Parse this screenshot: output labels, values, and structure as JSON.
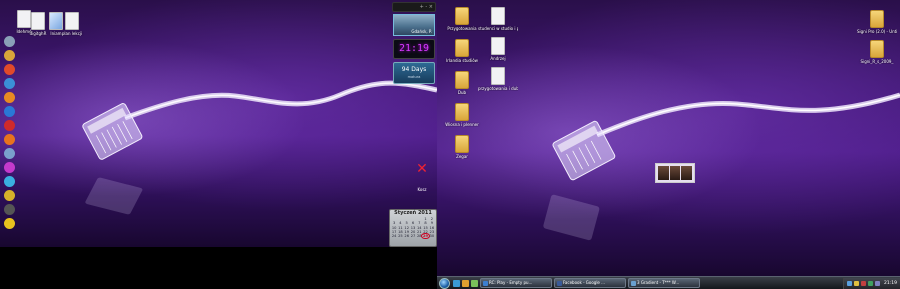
{
  "left_desktop": {
    "icons": [
      {
        "label": "Idehmé",
        "kind": "doc"
      },
      {
        "label": "digitghR",
        "kind": "doc"
      },
      {
        "label": "Iniam",
        "kind": "doc"
      },
      {
        "label": "plan lekcji",
        "kind": "doc"
      }
    ],
    "dock": [
      {
        "icon": "recycle-bin-icon",
        "color": "#8aa0b8"
      },
      {
        "icon": "folder-icon",
        "color": "#d9a53a"
      },
      {
        "icon": "chrome-icon",
        "color": "#e04a2a"
      },
      {
        "icon": "media-player-icon",
        "color": "#3b8fd6"
      },
      {
        "icon": "tools-icon",
        "color": "#e88a22"
      },
      {
        "icon": "internet-explorer-icon",
        "color": "#2a78d6"
      },
      {
        "icon": "opera-icon",
        "color": "#d02a2a"
      },
      {
        "icon": "firefox-icon",
        "color": "#e8731e"
      },
      {
        "icon": "user-icon",
        "color": "#7aa0cc"
      },
      {
        "icon": "help-icon",
        "color": "#c43acc"
      },
      {
        "icon": "globe-icon",
        "color": "#3ab0e0"
      },
      {
        "icon": "lock-icon",
        "color": "#d6b02a"
      },
      {
        "icon": "search-icon",
        "color": "#555555"
      },
      {
        "icon": "star-icon",
        "color": "#e8c21e"
      }
    ],
    "gadgets": {
      "topbar": "+ - ×",
      "photo_caption": "Gdańsk, P.",
      "clock_time": "21:19",
      "days_count": "94 Days",
      "days_caption": "matura",
      "recycle_label": "Kosz"
    },
    "calendar": {
      "title": "Styczeń 2011",
      "days": [
        "",
        "",
        "",
        "",
        "",
        "1",
        "2",
        "3",
        "4",
        "5",
        "6",
        "7",
        "8",
        "9",
        "10",
        "11",
        "12",
        "13",
        "14",
        "15",
        "16",
        "17",
        "18",
        "19",
        "20",
        "21",
        "22",
        "23",
        "24",
        "25",
        "26",
        "27",
        "28",
        "29",
        "30"
      ],
      "today": "29"
    }
  },
  "right_desktop": {
    "icons_col1": [
      {
        "label": "Przygotowania",
        "kind": "folder"
      },
      {
        "label": "Irlandia studiów",
        "kind": "folder"
      },
      {
        "label": "Dub",
        "kind": "folder"
      },
      {
        "label": "Wiosna i plenner",
        "kind": "folder"
      },
      {
        "label": "Zegar",
        "kind": "folder"
      }
    ],
    "icons_col2": [
      {
        "label": "studenci w studio i pogrzebany",
        "kind": "doc"
      },
      {
        "label": "Andrzej",
        "kind": "doc"
      },
      {
        "label": "przygotowania i dub",
        "kind": "doc"
      }
    ],
    "icons_col3": [
      {
        "label": "Signi Pro (2.0) - Untitled",
        "kind": "folder"
      },
      {
        "label": "Signi_R_s_2009_",
        "kind": "folder"
      }
    ]
  },
  "taskbar": {
    "buttons": [
      {
        "label": "RC: Play - Empty pu...",
        "color": "#3c7fd0"
      },
      {
        "label": "Facebook - Google ...",
        "color": "#3a5a98"
      },
      {
        "label": "3 Gradient - T*** W...",
        "color": "#6aa0d0"
      }
    ],
    "clock": "21:19"
  }
}
